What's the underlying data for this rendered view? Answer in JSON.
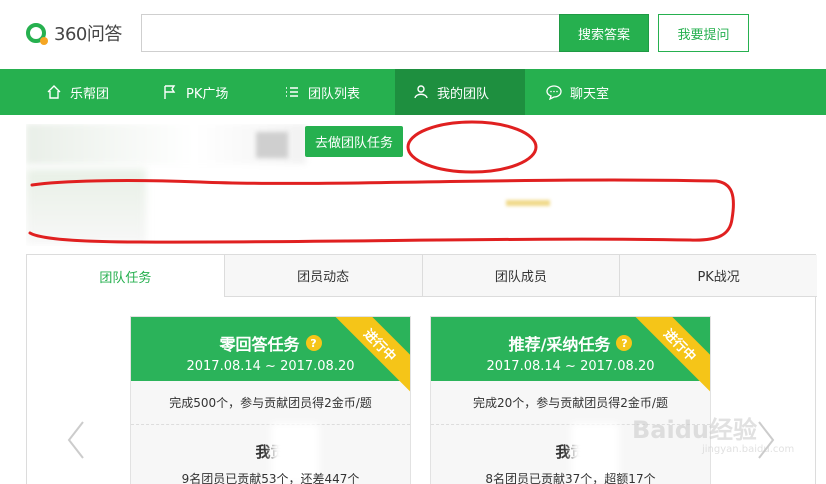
{
  "header": {
    "logo_text": "360问答",
    "search_value": "",
    "search_button": "搜索答案",
    "ask_button": "我要提问"
  },
  "nav": {
    "items": [
      {
        "label": "乐帮团",
        "icon": "home-icon"
      },
      {
        "label": "PK广场",
        "icon": "flag-icon"
      },
      {
        "label": "团队列表",
        "icon": "list-icon"
      },
      {
        "label": "我的团队",
        "icon": "team-icon"
      },
      {
        "label": "聊天室",
        "icon": "chat-icon"
      }
    ],
    "active_index": 3
  },
  "banner": {
    "task_button": "去做团队任务"
  },
  "tabs": {
    "items": [
      "团队任务",
      "团员动态",
      "团队成员",
      "PK战况"
    ],
    "active_index": 0
  },
  "cards": [
    {
      "title": "零回答任务",
      "date_range": "2017.08.14 ~ 2017.08.20",
      "ribbon": "进行中",
      "description": "完成500个，参与贡献团员得2金币/题",
      "contribution_title": "我贡",
      "stat": "9名团员已贡献53个，还差447个"
    },
    {
      "title": "推荐/采纳任务",
      "date_range": "2017.08.14 ~ 2017.08.20",
      "ribbon": "进行中",
      "description": "完成20个，参与贡献团员得2金币/题",
      "contribution_title": "我贡",
      "stat": "8名团员已贡献37个，超额17个"
    }
  ],
  "watermark": {
    "main": "Baidu经验",
    "sub": "jingyan.baidu.com"
  },
  "colors": {
    "brand_green": "#26b04f",
    "active_nav": "#1e8f3f",
    "ribbon_yellow": "#f5c518",
    "annotation_red": "#e02020"
  }
}
